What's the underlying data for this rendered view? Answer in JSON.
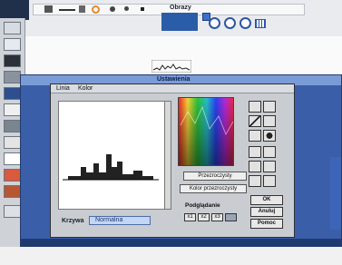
{
  "app": {
    "menu_label": "Obrazy"
  },
  "outer_window": {
    "title": "Ustawienia"
  },
  "dialog": {
    "menu": [
      "Linia",
      "Kolor"
    ],
    "curve_label": "Krzywa",
    "curve_value": "Normalna",
    "palette_button": "Przezroczysty",
    "transparent_button": "Kolor przezroczysty",
    "brightness_label": "Podglądanie",
    "small_buttons": [
      "x1",
      "x2",
      "x3"
    ],
    "side_buttons": [
      "OK",
      "Anuluj",
      "Pomoc"
    ]
  },
  "colors": {
    "window_blue": "#3b5ea9",
    "dialog_gray": "#c9ccd1",
    "titlebar": "#7b9bd6"
  }
}
